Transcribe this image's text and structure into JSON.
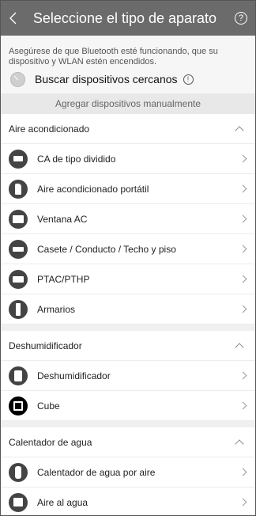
{
  "header": {
    "title": "Seleccione el tipo de aparato",
    "back_icon": "chevron-left-icon",
    "help_icon": "help-icon",
    "help_glyph": "?"
  },
  "info": {
    "notice": "Asegúrese de que Bluetooth esté funcionando, que su dispositivo y WLAN estén encendidos.",
    "scan_label": "Buscar dispositivos cercanos",
    "info_glyph": "!",
    "manual_label": "Agregar dispositivos manualmente"
  },
  "colors": {
    "header_bg": "#6b6b6b",
    "icon_bg": "#444444"
  },
  "sections": [
    {
      "title": "Aire acondicionado",
      "items": [
        {
          "label": "CA de tipo dividido",
          "icon": "split-ac-icon"
        },
        {
          "label": "Aire acondicionado portátil",
          "icon": "portable-ac-icon"
        },
        {
          "label": "Ventana AC",
          "icon": "window-ac-icon"
        },
        {
          "label": "Casete / Conducto / Techo y piso",
          "icon": "cassette-ac-icon"
        },
        {
          "label": "PTAC/PTHP",
          "icon": "ptac-icon"
        },
        {
          "label": "Armarios",
          "icon": "cabinet-icon"
        }
      ]
    },
    {
      "title": "Deshumidificador",
      "items": [
        {
          "label": "Deshumidificador",
          "icon": "dehumidifier-icon"
        },
        {
          "label": "Cube",
          "icon": "cube-icon"
        }
      ]
    },
    {
      "title": "Calentador de agua",
      "items": [
        {
          "label": "Calentador de agua por aire",
          "icon": "air-water-heater-icon"
        },
        {
          "label": "Aire al agua",
          "icon": "air-to-water-icon"
        }
      ]
    }
  ]
}
